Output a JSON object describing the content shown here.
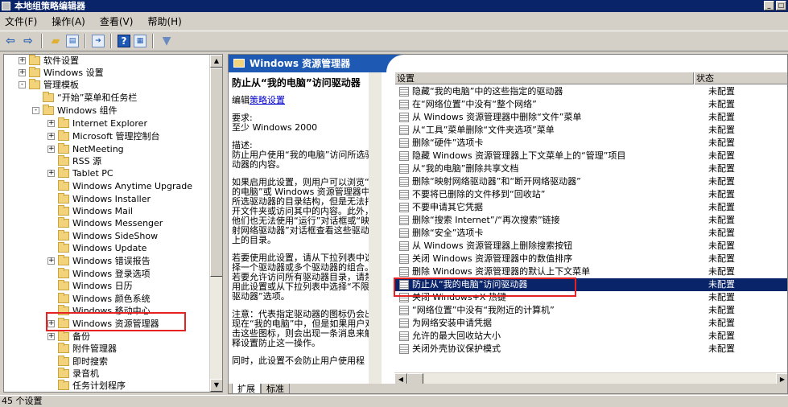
{
  "window": {
    "title": "本地组策略编辑器"
  },
  "menu": {
    "items": [
      "文件(F)",
      "操作(A)",
      "查看(V)",
      "帮助(H)"
    ]
  },
  "tree": {
    "items": [
      {
        "label": "软件设置",
        "expander": "+"
      },
      {
        "label": "Windows 设置",
        "expander": "+"
      },
      {
        "label": "管理模板",
        "expander": "-"
      },
      {
        "label": "“开始”菜单和任务栏",
        "expander": ""
      },
      {
        "label": "Windows 组件",
        "expander": "-"
      },
      {
        "label": "Internet Explorer",
        "expander": "+"
      },
      {
        "label": "Microsoft 管理控制台",
        "expander": "+"
      },
      {
        "label": "NetMeeting",
        "expander": "+"
      },
      {
        "label": "RSS 源",
        "expander": ""
      },
      {
        "label": "Tablet PC",
        "expander": "+"
      },
      {
        "label": "Windows Anytime Upgrade",
        "expander": ""
      },
      {
        "label": "Windows Installer",
        "expander": ""
      },
      {
        "label": "Windows Mail",
        "expander": ""
      },
      {
        "label": "Windows Messenger",
        "expander": ""
      },
      {
        "label": "Windows SideShow",
        "expander": ""
      },
      {
        "label": "Windows Update",
        "expander": ""
      },
      {
        "label": "Windows 错误报告",
        "expander": "+"
      },
      {
        "label": "Windows 登录选项",
        "expander": ""
      },
      {
        "label": "Windows 日历",
        "expander": ""
      },
      {
        "label": "Windows 颜色系统",
        "expander": ""
      },
      {
        "label": "Windows 移动中心",
        "expander": ""
      },
      {
        "label": "Windows 资源管理器",
        "expander": "+"
      },
      {
        "label": "备份",
        "expander": "+"
      },
      {
        "label": "附件管理器",
        "expander": ""
      },
      {
        "label": "即时搜索",
        "expander": ""
      },
      {
        "label": "录音机",
        "expander": ""
      },
      {
        "label": "任务计划程序",
        "expander": ""
      }
    ]
  },
  "right": {
    "header_title": "Windows 资源管理器",
    "description": {
      "title": "防止从“我的电脑”访问驱动器",
      "edit_prefix": "编辑",
      "edit_link": "策略设置",
      "req_label": "要求:",
      "req_value": "至少 Windows 2000",
      "desc_label": "描述:",
      "desc_text": "防止用户使用“我的电脑”访问所选驱动器的内容。",
      "para1": "如果启用此设置，则用户可以浏览“我的电脑”或 Windows 资源管理器中所选驱动器的目录结构，但是无法打开文件夹或访问其中的内容。此外，他们也无法使用“运行”对话框或“映射网络驱动器”对话框查看这些驱动器上的目录。",
      "para2": "若要使用此设置，请从下拉列表中选择一个驱动器或多个驱动器的组合。若要允许访问所有驱动器目录，请禁用此设置或从下拉列表中选择“不限制驱动器”选项。",
      "para3": "注意：代表指定驱动器的图标仍会出现在“我的电脑”中，但是如果用户双击这些图标，则会出现一条消息来解释设置防止这一操作。",
      "para4": "同时，此设置不会防止用户使用程"
    },
    "columns": {
      "name": "设置",
      "state": "状态"
    },
    "rows": [
      {
        "name": "隐藏“我的电脑”中的这些指定的驱动器",
        "state": "未配置"
      },
      {
        "name": "在“网络位置”中没有“整个网络”",
        "state": "未配置"
      },
      {
        "name": "从 Windows 资源管理器中删除“文件”菜单",
        "state": "未配置"
      },
      {
        "name": "从“工具”菜单删除“文件夹选项”菜单",
        "state": "未配置"
      },
      {
        "name": "删除“硬件”选项卡",
        "state": "未配置"
      },
      {
        "name": "隐藏 Windows 资源管理器上下文菜单上的“管理”项目",
        "state": "未配置"
      },
      {
        "name": "从“我的电脑”删除共享文档",
        "state": "未配置"
      },
      {
        "name": "删除“映射网络驱动器”和“断开网络驱动器”",
        "state": "未配置"
      },
      {
        "name": "不要将已删除的文件移到“回收站”",
        "state": "未配置"
      },
      {
        "name": "不要申请其它凭据",
        "state": "未配置"
      },
      {
        "name": "删除“搜索 Internet”/“再次搜索”链接",
        "state": "未配置"
      },
      {
        "name": "删除“安全”选项卡",
        "state": "未配置"
      },
      {
        "name": "从 Windows 资源管理器上删除搜索按钮",
        "state": "未配置"
      },
      {
        "name": "关闭 Windows 资源管理器中的数值排序",
        "state": "未配置"
      },
      {
        "name": "删除 Windows 资源管理器的默认上下文菜单",
        "state": "未配置"
      },
      {
        "name": "防止从“我的电脑”访问驱动器",
        "state": "未配置"
      },
      {
        "name": "关闭 Windows+X 热键",
        "state": "未配置"
      },
      {
        "name": "“网络位置”中没有“我附近的计算机”",
        "state": "未配置"
      },
      {
        "name": "为网络安装申请凭据",
        "state": "未配置"
      },
      {
        "name": "允许的最大回收站大小",
        "state": "未配置"
      },
      {
        "name": "关闭外壳协议保护模式",
        "state": "未配置"
      }
    ],
    "tabs": [
      "扩展",
      "标准"
    ]
  },
  "status": {
    "text": "45 个设置"
  }
}
